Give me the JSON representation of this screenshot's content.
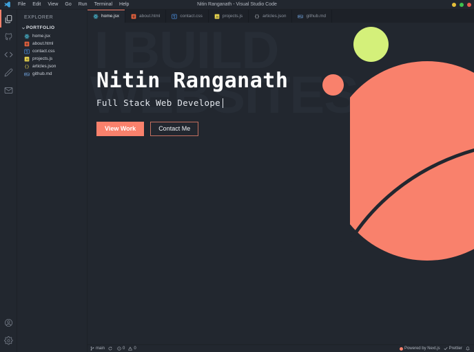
{
  "window": {
    "title": "Nitin Ranganath - Visual Studio Code",
    "logo_icon": "vscode-logo-icon",
    "buttons": [
      {
        "name": "minimize-button",
        "icon": "minimize-dot-icon",
        "color": "#e6c03a"
      },
      {
        "name": "maximize-button",
        "icon": "maximize-dot-icon",
        "color": "#3ec14e"
      },
      {
        "name": "close-button",
        "icon": "close-dot-icon",
        "color": "#ec5c4f"
      }
    ]
  },
  "menu": {
    "items": [
      {
        "label": "File",
        "name": "menu-file"
      },
      {
        "label": "Edit",
        "name": "menu-edit"
      },
      {
        "label": "View",
        "name": "menu-view"
      },
      {
        "label": "Go",
        "name": "menu-go"
      },
      {
        "label": "Run",
        "name": "menu-run"
      },
      {
        "label": "Terminal",
        "name": "menu-terminal"
      },
      {
        "label": "Help",
        "name": "menu-help"
      }
    ]
  },
  "activitybar": {
    "top": [
      {
        "name": "activitybar-explorer",
        "icon": "files-icon",
        "active": true
      },
      {
        "name": "activitybar-source-control",
        "icon": "github-cat-icon",
        "active": false
      },
      {
        "name": "activitybar-code",
        "icon": "code-brackets-icon",
        "active": false
      },
      {
        "name": "activitybar-blog",
        "icon": "pencil-icon",
        "active": false
      },
      {
        "name": "activitybar-contact",
        "icon": "envelope-icon",
        "active": false
      }
    ],
    "bottom": [
      {
        "name": "activitybar-account",
        "icon": "account-circle-icon"
      },
      {
        "name": "activitybar-settings",
        "icon": "gear-icon"
      }
    ]
  },
  "sidebar": {
    "title": "EXPLORER",
    "folder": {
      "label": "PORTFOLIO",
      "chevron_icon": "chevron-down-icon",
      "expanded": true
    },
    "files": [
      {
        "name": "home.jsx",
        "icon": "react-icon",
        "color": "#4cc6e0"
      },
      {
        "name": "about.html",
        "icon": "html-icon",
        "color": "#e8623c"
      },
      {
        "name": "contact.css",
        "icon": "css-icon",
        "color": "#4a8fe0"
      },
      {
        "name": "projects.js",
        "icon": "javascript-icon",
        "color": "#e8d44d"
      },
      {
        "name": "articles.json",
        "icon": "json-icon",
        "color": "#e8d44d"
      },
      {
        "name": "github.md",
        "icon": "markdown-icon",
        "color": "#6e9fd8"
      }
    ]
  },
  "tabs": [
    {
      "label": "home.jsx",
      "icon": "react-icon",
      "color": "#4cc6e0",
      "active": true
    },
    {
      "label": "about.html",
      "icon": "html-icon",
      "color": "#e8623c",
      "active": false
    },
    {
      "label": "contact.css",
      "icon": "css-icon",
      "color": "#4a8fe0",
      "active": false
    },
    {
      "label": "projects.js",
      "icon": "javascript-icon",
      "color": "#e8d44d",
      "active": false
    },
    {
      "label": "articles.json",
      "icon": "json-icon",
      "color": "#c9cdd4",
      "active": false
    },
    {
      "label": "github.md",
      "icon": "markdown-icon",
      "color": "#6e9fd8",
      "active": false
    }
  ],
  "hero": {
    "watermark_line1": "I BUILD",
    "watermark_line2": "WEBSITES",
    "name": "Nitin Ranganath",
    "subtitle": "Full Stack Web Develope",
    "primary_button": "View Work",
    "secondary_button": "Contact Me"
  },
  "colors": {
    "coral": "#f9816c",
    "lime": "#d4f07a",
    "editor_bg": "#22272f",
    "tabbar_bg": "#1d2128",
    "watermark": "#272d36",
    "accent_outline": "#c4705f"
  },
  "statusbar": {
    "left": [
      {
        "name": "status-branch",
        "icon": "source-control-branch-icon",
        "label": "main"
      },
      {
        "name": "status-sync",
        "icon": "sync-icon",
        "label": ""
      },
      {
        "name": "status-errors",
        "icon": "error-icon",
        "label": "0"
      },
      {
        "name": "status-warnings",
        "icon": "warning-icon",
        "label": "0"
      }
    ],
    "right": [
      {
        "name": "status-powered-by",
        "icon": "nextjs-dot-icon",
        "label": "Powered by Next.js"
      },
      {
        "name": "status-prettier",
        "icon": "check-icon",
        "label": "Prettier"
      },
      {
        "name": "status-notifications",
        "icon": "bell-icon",
        "label": ""
      }
    ]
  }
}
